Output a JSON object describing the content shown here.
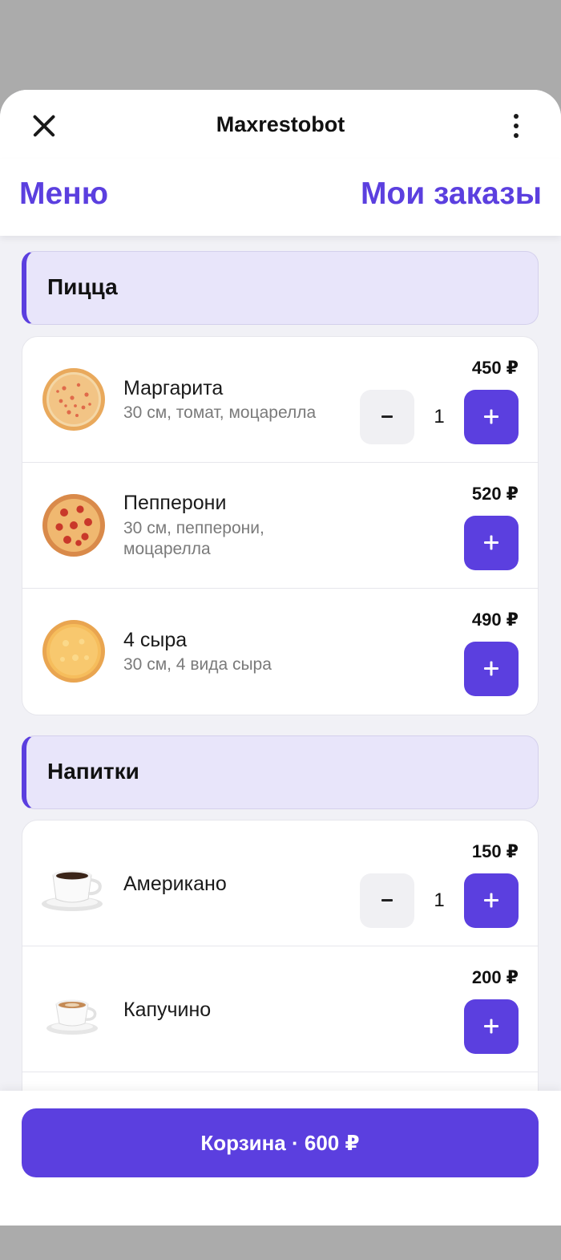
{
  "header": {
    "title": "Maxrestobot"
  },
  "tabs": {
    "menu": "Меню",
    "orders": "Мои заказы"
  },
  "sections": [
    {
      "title": "Пицца",
      "items": [
        {
          "name": "Маргарита",
          "desc": "30 см, томат, моцарелла",
          "price": "450 ₽",
          "qty": "1",
          "image": "pizza-margherita"
        },
        {
          "name": "Пепперони",
          "desc": "30 см, пепперони, моцарелла",
          "price": "520 ₽",
          "image": "pizza-pepperoni"
        },
        {
          "name": "4 сыра",
          "desc": "30 см, 4 вида сыра",
          "price": "490 ₽",
          "image": "pizza-four-cheese"
        }
      ]
    },
    {
      "title": "Напитки",
      "items": [
        {
          "name": "Американо",
          "price": "150 ₽",
          "qty": "1",
          "image": "coffee-americano"
        },
        {
          "name": "Капучино",
          "price": "200 ₽",
          "image": "coffee-cappuccino"
        }
      ]
    }
  ],
  "cart": {
    "label": "Корзина · 600 ₽"
  },
  "colors": {
    "accent": "#5b3fdf",
    "section_bg": "#e8e5fa",
    "page_bg": "#f1f1f6"
  }
}
